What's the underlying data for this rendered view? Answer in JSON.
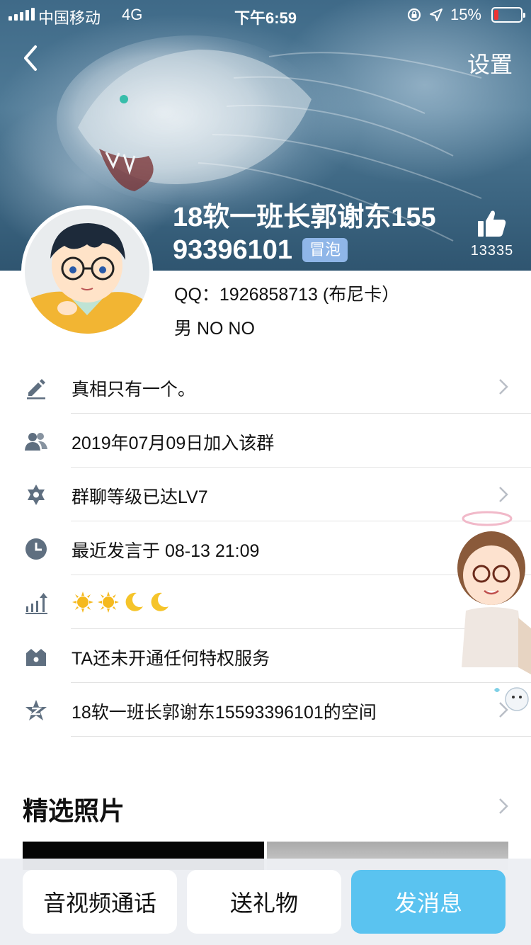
{
  "status_bar": {
    "carrier": "中国移动",
    "network": "4G",
    "time": "下午6:59",
    "battery_percent": "15%",
    "battery_level": 0.15
  },
  "nav": {
    "settings_label": "设置"
  },
  "profile": {
    "name_line1": "18软一班长郭谢东155",
    "name_line2": "93396101",
    "tag": "冒泡",
    "likes": "13335",
    "qq": "QQ：1926858713 (布尼卡）",
    "gender_line": "男  NO  NO"
  },
  "rows": [
    {
      "icon": "edit-icon",
      "text": "真相只有一个。",
      "chevron": true
    },
    {
      "icon": "group-icon",
      "text": "2019年07月09日加入该群",
      "chevron": false
    },
    {
      "icon": "star-badge-icon",
      "text": "群聊等级已达LV7",
      "chevron": true
    },
    {
      "icon": "clock-icon",
      "text": "最近发言于 08-13 21:09",
      "chevron": false
    },
    {
      "icon": "level-chart-icon",
      "text": "",
      "chevron": false
    },
    {
      "icon": "crown-icon",
      "text": "TA还未开通任何特权服务",
      "chevron": true
    },
    {
      "icon": "qzone-icon",
      "text": "18软一班长郭谢东15593396101的空间",
      "chevron": true
    }
  ],
  "photos": {
    "title": "精选照片"
  },
  "buttons": {
    "call": "音视频通话",
    "gift": "送礼物",
    "message": "发消息"
  },
  "colors": {
    "accent": "#5ac3f0",
    "tag_bg": "#8fb6e8",
    "icon": "#5f6f80"
  }
}
